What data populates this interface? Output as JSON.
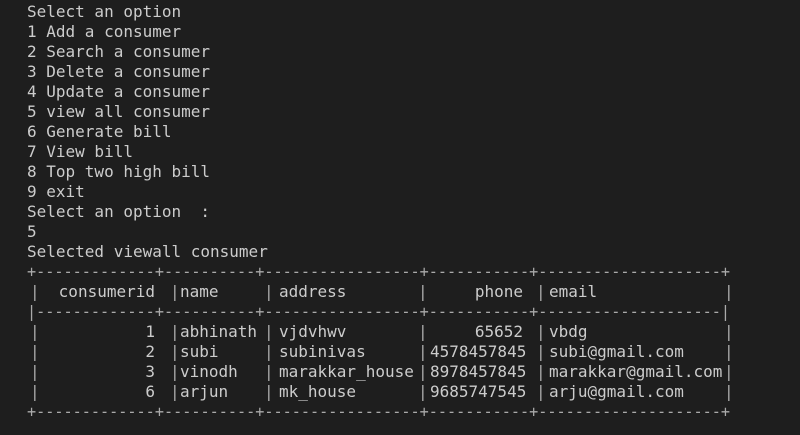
{
  "terminal": {
    "lines": [
      "Select an option",
      "1 Add a consumer",
      "2 Search a consumer",
      "3 Delete a consumer",
      "4 Update a consumer",
      "5 view all consumer",
      "6 Generate bill",
      "7 View bill",
      "8 Top two high bill",
      "9 exit",
      "Select an option  :",
      "5",
      "Selected viewall consumer"
    ],
    "table": {
      "border_top": "+-------------+----------+-----------------+-----------+--------------------+",
      "header_separator": "|-------------+----------+-----------------+-----------+--------------------|",
      "border_bottom": "+-------------+----------+-----------------+-----------+--------------------+",
      "columns": [
        "consumerid",
        "name",
        "address",
        "phone",
        "email"
      ],
      "rows": [
        [
          "1",
          "abhinath",
          "vjdvhwv",
          "65652",
          "vbdg"
        ],
        [
          "2",
          "subi",
          "subinivas",
          "4578457845",
          "subi@gmail.com"
        ],
        [
          "3",
          "vinodh",
          "marakkar_house",
          "8978457845",
          "marakkar@gmail.com"
        ],
        [
          "6",
          "arjun",
          "mk_house",
          "9685747545",
          "arju@gmail.com"
        ]
      ]
    }
  },
  "colors": {
    "background": "#1e1e1e",
    "text": "#cccccc"
  }
}
